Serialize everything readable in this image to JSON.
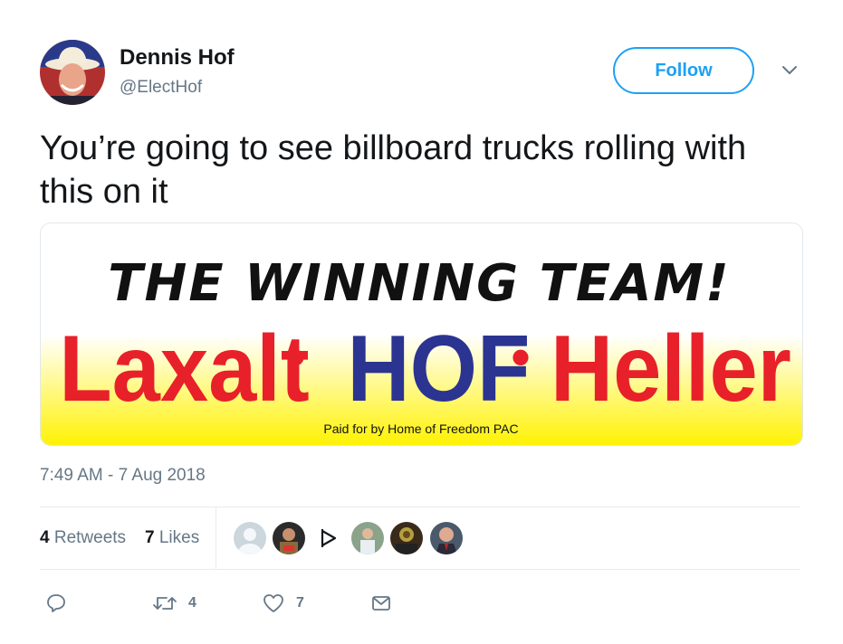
{
  "author": {
    "name": "Dennis Hof",
    "handle": "@ElectHof"
  },
  "follow_label": "Follow",
  "tweet_text": "You’re going to see billboard trucks rolling with this on it",
  "media": {
    "headline": "THE WINNING TEAM!",
    "names": [
      "Laxalt",
      "HOF",
      "Heller"
    ],
    "separator": "•",
    "disclaimer": "Paid for by Home of Freedom PAC",
    "colors": {
      "red": "#e8202a",
      "blue": "#2b3491",
      "yellow": "#fff200"
    }
  },
  "timestamp": "7:49 AM - 7 Aug 2018",
  "stats": {
    "retweets_count": "4",
    "retweets_label": "Retweets",
    "likes_count": "7",
    "likes_label": "Likes"
  },
  "likers": [
    "default-avatar",
    "user-avatar",
    "play-badge-avatar",
    "user-avatar",
    "user-avatar",
    "user-avatar"
  ],
  "actions": {
    "reply": "",
    "retweet_count": "4",
    "like_count": "7",
    "dm": ""
  },
  "colors": {
    "accent": "#1da1f2",
    "muted": "#657786",
    "text": "#14171a"
  }
}
